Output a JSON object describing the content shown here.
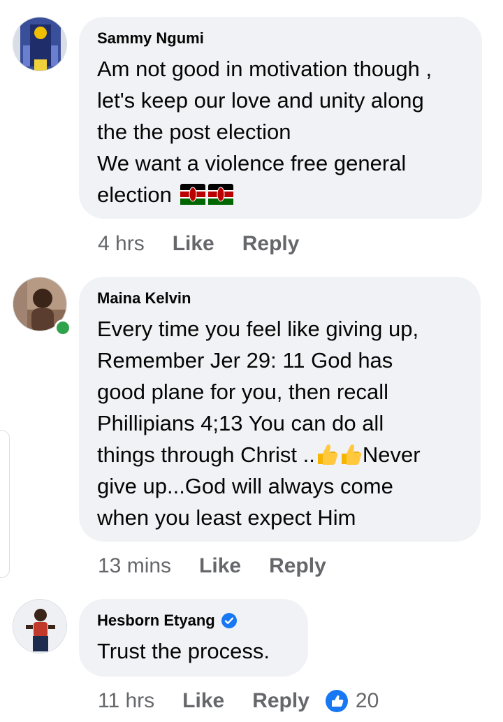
{
  "comments": [
    {
      "author": "Sammy Ngumi",
      "lines": [
        "Am not good in motivation though ,",
        "let's keep our love and unity along",
        "the the post election",
        "We want a violence free general",
        "election"
      ],
      "emoji": [
        "kenya-flag-icon",
        "kenya-flag-icon"
      ],
      "time": "4 hrs",
      "like_label": "Like",
      "reply_label": "Reply"
    },
    {
      "author": "Maina Kelvin",
      "online": true,
      "lines": [
        "Every time you feel like giving up,",
        "Remember Jer 29: 11 God has",
        "good plane for you, then recall",
        "Phillipians 4;13 You can do all",
        "things through Christ ..",
        "give up...God will always come",
        "when you least expect Him"
      ],
      "line5_after_emoji": "Never",
      "emoji": [
        "thumbs-up-icon",
        "thumbs-up-icon"
      ],
      "time": "13 mins",
      "like_label": "Like",
      "reply_label": "Reply"
    },
    {
      "author": "Hesborn Etyang",
      "verified": true,
      "lines": [
        "Trust the process."
      ],
      "time": "11 hrs",
      "like_label": "Like",
      "reply_label": "Reply",
      "reaction_count": "20"
    }
  ],
  "colors": {
    "bubble": "#f0f2f5",
    "meta_text": "#65676b",
    "online": "#31a24c",
    "verified": "#1877f2",
    "like_reaction": "#1877f2"
  }
}
